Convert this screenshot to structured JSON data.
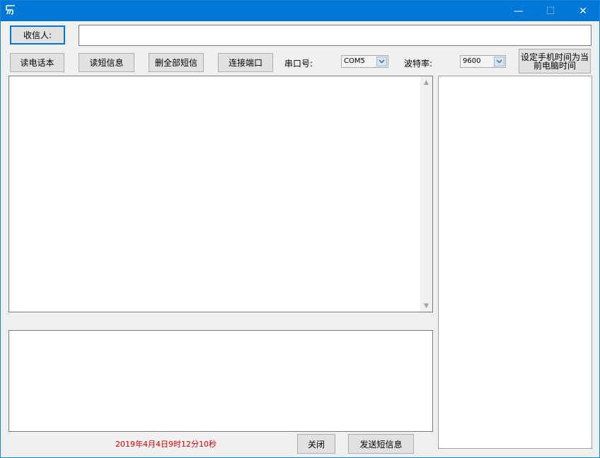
{
  "window": {
    "icon": "app-icon",
    "controls": {
      "minimize": "—",
      "maximize": "☐",
      "close": "✕"
    }
  },
  "recipient": {
    "button_label": "收信人:",
    "value": ""
  },
  "toolbar": {
    "read_phonebook": "读电话本",
    "read_sms": "读短信息",
    "delete_all_sms": "删全部短信",
    "connect_port": "连接端口",
    "port_label": "串口号:",
    "port_value": "COM5",
    "baud_label": "波特率:",
    "baud_value": "9600",
    "sync_time": "设定手机时间为当前电脑时间"
  },
  "messages": {
    "content": ""
  },
  "compose": {
    "content": ""
  },
  "side_panel": {
    "content": ""
  },
  "footer": {
    "timestamp": "2019年4月4日9时12分10秒",
    "close_label": "关闭",
    "send_label": "发送短信息",
    "timestamp_color": "#e00000"
  }
}
